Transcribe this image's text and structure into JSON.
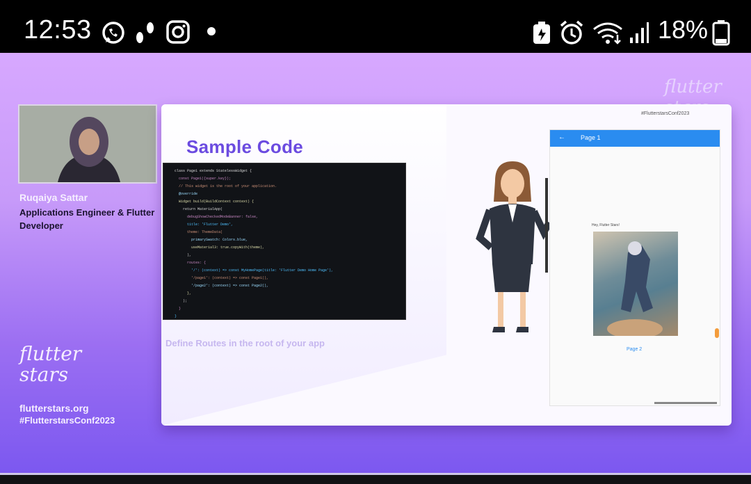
{
  "status_bar": {
    "time": "12:53",
    "battery": "18%",
    "icons": [
      "whatsapp-icon",
      "footsteps-icon",
      "instagram-icon",
      "dot-icon",
      "battery-saver-icon",
      "alarm-icon",
      "wifi-icon",
      "signal-icon",
      "battery-icon"
    ]
  },
  "speaker": {
    "name": "Ruqaiya Sattar",
    "role": "Applications Engineer & Flutter Developer"
  },
  "brand": {
    "logo_text": "flutter stars",
    "site": "flutterstars.org",
    "hashtag": "#FlutterstarsConf2023"
  },
  "slide": {
    "title": "Sample Code",
    "caption": "Define Routes in the root of your app",
    "code_lines": [
      "  class Page1 extends StatelessWidget {",
      "    const Page1({super.key});",
      "",
      "    // This widget is the root of your application.",
      "    @override",
      "    Widget build(BuildContext context) {",
      "      return MaterialApp(",
      "        debugShowCheckedModeBanner: false,",
      "        title: 'Flutter Demo',",
      "        theme: ThemeData(",
      "          primarySwatch: Colors.blue,",
      "          useMaterial3: true.copyWith(theme),",
      "        ),",
      "        routes: {",
      "          '/': (context) => const MyHomePage(title: 'Flutter Demo Home Page'),",
      "          '/page1': (context) => const Page1(),",
      "          '/page2': (context) => const Page2(),",
      "        },",
      "      );",
      "    }",
      "  }"
    ],
    "phone": {
      "appbar_title": "Page 1",
      "body_text": "Hey, Flutter Stars!",
      "link_text": "Page 2"
    }
  },
  "colors": {
    "accent": "#6b4be0",
    "appbar": "#2a8cf0",
    "background_top": "#d7a8ff",
    "background_bottom": "#7c58f0"
  }
}
